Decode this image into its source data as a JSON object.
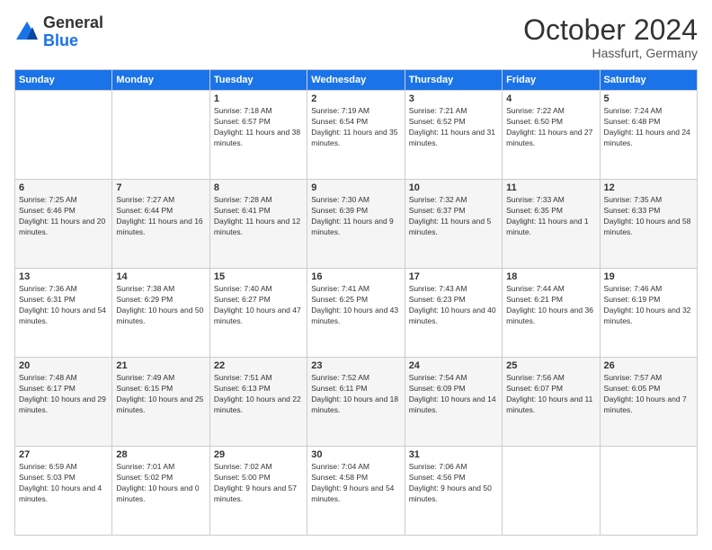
{
  "logo": {
    "general": "General",
    "blue": "Blue"
  },
  "header": {
    "month": "October 2024",
    "location": "Hassfurt, Germany"
  },
  "weekdays": [
    "Sunday",
    "Monday",
    "Tuesday",
    "Wednesday",
    "Thursday",
    "Friday",
    "Saturday"
  ],
  "weeks": [
    [
      {
        "day": "",
        "info": ""
      },
      {
        "day": "",
        "info": ""
      },
      {
        "day": "1",
        "info": "Sunrise: 7:18 AM\nSunset: 6:57 PM\nDaylight: 11 hours and 38 minutes."
      },
      {
        "day": "2",
        "info": "Sunrise: 7:19 AM\nSunset: 6:54 PM\nDaylight: 11 hours and 35 minutes."
      },
      {
        "day": "3",
        "info": "Sunrise: 7:21 AM\nSunset: 6:52 PM\nDaylight: 11 hours and 31 minutes."
      },
      {
        "day": "4",
        "info": "Sunrise: 7:22 AM\nSunset: 6:50 PM\nDaylight: 11 hours and 27 minutes."
      },
      {
        "day": "5",
        "info": "Sunrise: 7:24 AM\nSunset: 6:48 PM\nDaylight: 11 hours and 24 minutes."
      }
    ],
    [
      {
        "day": "6",
        "info": "Sunrise: 7:25 AM\nSunset: 6:46 PM\nDaylight: 11 hours and 20 minutes."
      },
      {
        "day": "7",
        "info": "Sunrise: 7:27 AM\nSunset: 6:44 PM\nDaylight: 11 hours and 16 minutes."
      },
      {
        "day": "8",
        "info": "Sunrise: 7:28 AM\nSunset: 6:41 PM\nDaylight: 11 hours and 12 minutes."
      },
      {
        "day": "9",
        "info": "Sunrise: 7:30 AM\nSunset: 6:39 PM\nDaylight: 11 hours and 9 minutes."
      },
      {
        "day": "10",
        "info": "Sunrise: 7:32 AM\nSunset: 6:37 PM\nDaylight: 11 hours and 5 minutes."
      },
      {
        "day": "11",
        "info": "Sunrise: 7:33 AM\nSunset: 6:35 PM\nDaylight: 11 hours and 1 minute."
      },
      {
        "day": "12",
        "info": "Sunrise: 7:35 AM\nSunset: 6:33 PM\nDaylight: 10 hours and 58 minutes."
      }
    ],
    [
      {
        "day": "13",
        "info": "Sunrise: 7:36 AM\nSunset: 6:31 PM\nDaylight: 10 hours and 54 minutes."
      },
      {
        "day": "14",
        "info": "Sunrise: 7:38 AM\nSunset: 6:29 PM\nDaylight: 10 hours and 50 minutes."
      },
      {
        "day": "15",
        "info": "Sunrise: 7:40 AM\nSunset: 6:27 PM\nDaylight: 10 hours and 47 minutes."
      },
      {
        "day": "16",
        "info": "Sunrise: 7:41 AM\nSunset: 6:25 PM\nDaylight: 10 hours and 43 minutes."
      },
      {
        "day": "17",
        "info": "Sunrise: 7:43 AM\nSunset: 6:23 PM\nDaylight: 10 hours and 40 minutes."
      },
      {
        "day": "18",
        "info": "Sunrise: 7:44 AM\nSunset: 6:21 PM\nDaylight: 10 hours and 36 minutes."
      },
      {
        "day": "19",
        "info": "Sunrise: 7:46 AM\nSunset: 6:19 PM\nDaylight: 10 hours and 32 minutes."
      }
    ],
    [
      {
        "day": "20",
        "info": "Sunrise: 7:48 AM\nSunset: 6:17 PM\nDaylight: 10 hours and 29 minutes."
      },
      {
        "day": "21",
        "info": "Sunrise: 7:49 AM\nSunset: 6:15 PM\nDaylight: 10 hours and 25 minutes."
      },
      {
        "day": "22",
        "info": "Sunrise: 7:51 AM\nSunset: 6:13 PM\nDaylight: 10 hours and 22 minutes."
      },
      {
        "day": "23",
        "info": "Sunrise: 7:52 AM\nSunset: 6:11 PM\nDaylight: 10 hours and 18 minutes."
      },
      {
        "day": "24",
        "info": "Sunrise: 7:54 AM\nSunset: 6:09 PM\nDaylight: 10 hours and 14 minutes."
      },
      {
        "day": "25",
        "info": "Sunrise: 7:56 AM\nSunset: 6:07 PM\nDaylight: 10 hours and 11 minutes."
      },
      {
        "day": "26",
        "info": "Sunrise: 7:57 AM\nSunset: 6:05 PM\nDaylight: 10 hours and 7 minutes."
      }
    ],
    [
      {
        "day": "27",
        "info": "Sunrise: 6:59 AM\nSunset: 5:03 PM\nDaylight: 10 hours and 4 minutes."
      },
      {
        "day": "28",
        "info": "Sunrise: 7:01 AM\nSunset: 5:02 PM\nDaylight: 10 hours and 0 minutes."
      },
      {
        "day": "29",
        "info": "Sunrise: 7:02 AM\nSunset: 5:00 PM\nDaylight: 9 hours and 57 minutes."
      },
      {
        "day": "30",
        "info": "Sunrise: 7:04 AM\nSunset: 4:58 PM\nDaylight: 9 hours and 54 minutes."
      },
      {
        "day": "31",
        "info": "Sunrise: 7:06 AM\nSunset: 4:56 PM\nDaylight: 9 hours and 50 minutes."
      },
      {
        "day": "",
        "info": ""
      },
      {
        "day": "",
        "info": ""
      }
    ]
  ]
}
